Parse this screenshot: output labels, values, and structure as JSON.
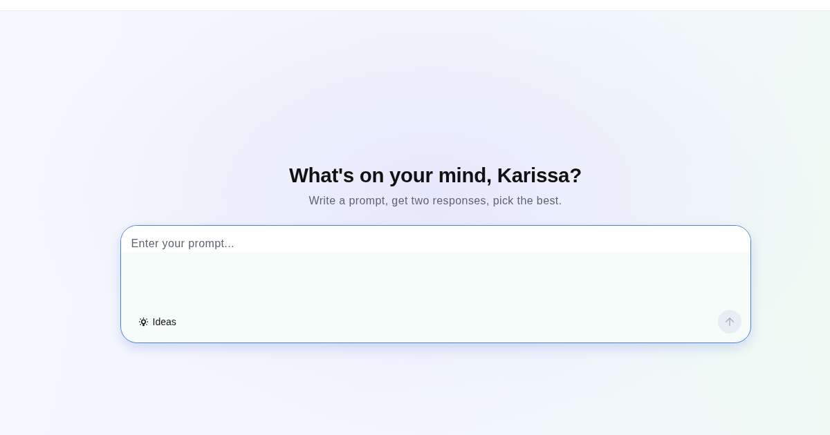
{
  "header": {
    "title": "What's on your mind, Karissa?",
    "subtitle": "Write a prompt, get two responses, pick the best."
  },
  "prompt": {
    "placeholder": "Enter your prompt...",
    "ideas_button": {
      "label": "Ideas"
    },
    "send_button": {
      "disabled": true
    }
  }
}
